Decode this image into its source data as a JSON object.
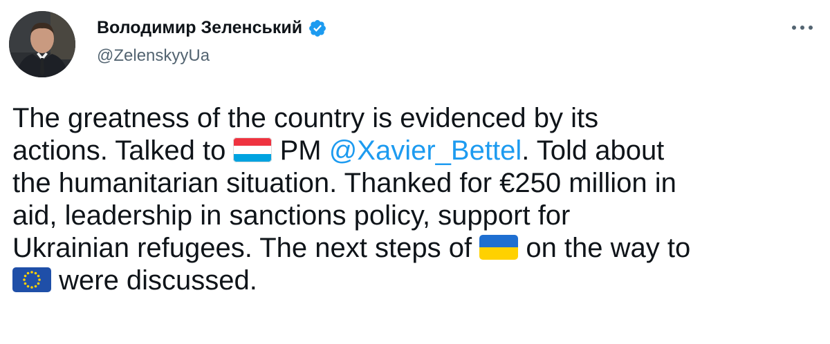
{
  "author": {
    "display_name": "Володимир Зеленський",
    "handle": "@ZelenskyyUa",
    "verified": true,
    "avatar_icon": "profile-photo-icon"
  },
  "menu": {
    "icon": "more-options-icon"
  },
  "tweet": {
    "line1": "The greatness of the country is evidenced by its",
    "line2_a": "actions. Talked to ",
    "flag1": "luxembourg-flag-icon",
    "line2_b": " PM ",
    "mention": "@Xavier_Bettel",
    "line2_c": ". Told about",
    "line3": "the humanitarian situation. Thanked for €250 million in",
    "line4": "aid, leadership in sanctions policy, support for",
    "line5_a": "Ukrainian refugees. The next steps of ",
    "flag2": "ukraine-flag-icon",
    "line5_b": " on the way to",
    "flag3": "eu-flag-icon",
    "line6": " were discussed."
  },
  "colors": {
    "link": "#1d9bf0",
    "secondary_text": "#536471",
    "verified_badge": "#1d9bf0"
  }
}
